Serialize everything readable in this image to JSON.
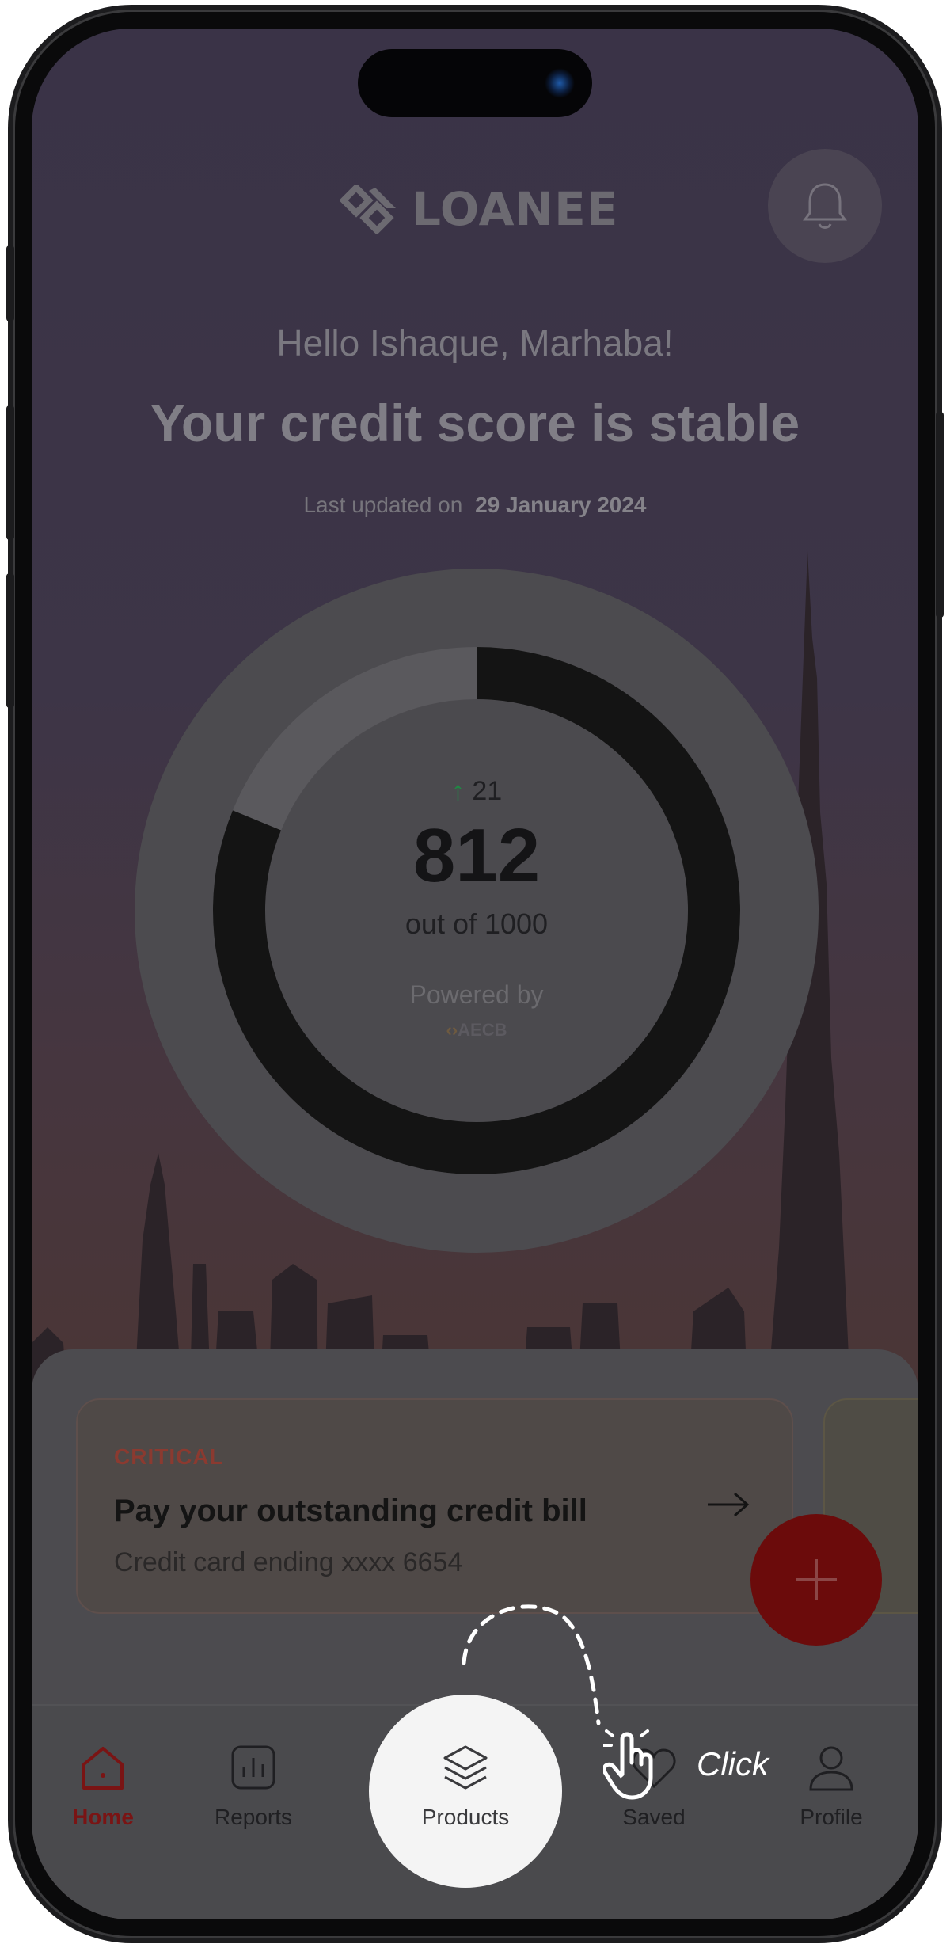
{
  "app": {
    "name": "LOANEE"
  },
  "header": {
    "greeting": "Hello Ishaque, Marhaba!",
    "headline": "Your credit score is stable",
    "updated_prefix": "Last updated on",
    "updated_date": "29 January 2024"
  },
  "score": {
    "delta": "21",
    "value": "812",
    "out_of": "out of 1000",
    "fraction": 0.812,
    "powered_by": "Powered by",
    "provider": "AECB"
  },
  "alerts": [
    {
      "level": "CRITICAL",
      "title": "Pay your outstanding credit bill",
      "subtitle": "Credit card ending xxxx 6654"
    }
  ],
  "nav": {
    "items": [
      {
        "label": "Home",
        "icon": "home-icon",
        "active": true
      },
      {
        "label": "Reports",
        "icon": "reports-icon",
        "active": false
      },
      {
        "label": "Products",
        "icon": "layers-icon",
        "active": false
      },
      {
        "label": "Saved",
        "icon": "heart-icon",
        "active": false
      },
      {
        "label": "Profile",
        "icon": "user-icon",
        "active": false
      }
    ]
  },
  "hint": {
    "text": "Click"
  },
  "colors": {
    "accent": "#7a1414",
    "fab": "#6b0b0b",
    "positive": "#1f8a44"
  }
}
